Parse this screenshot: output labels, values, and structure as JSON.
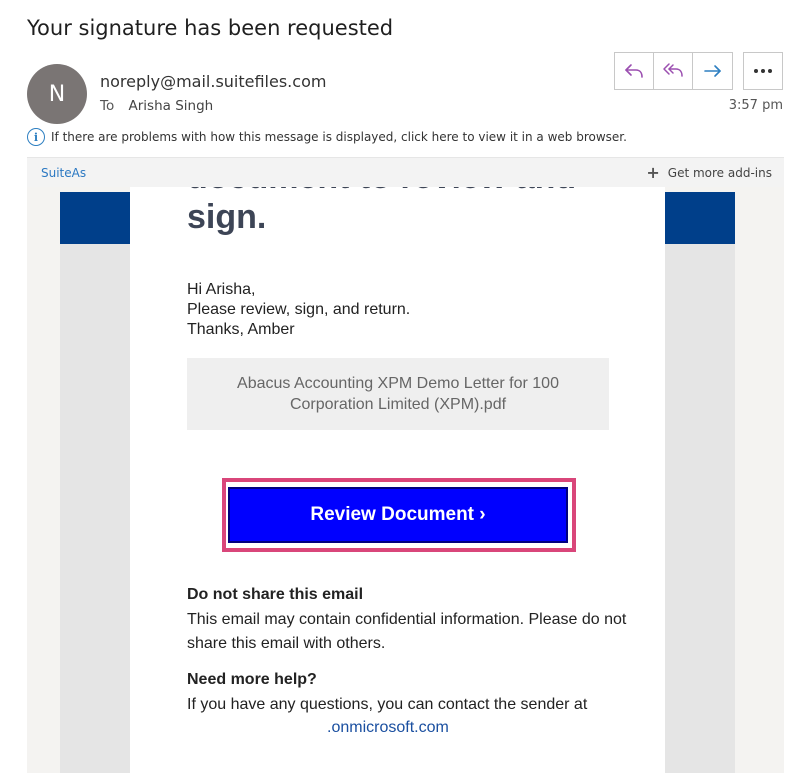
{
  "email": {
    "subject": "Your signature has been requested",
    "sender_initial": "N",
    "sender": "noreply@mail.suitefiles.com",
    "to_label": "To",
    "recipient": "Arisha Singh",
    "time": "3:57 pm",
    "info_message": "If there are problems with how this message is displayed, click here to view it in a web browser."
  },
  "toolbar": {
    "reply_icon": "reply-icon",
    "reply_all_icon": "reply-all-icon",
    "forward_icon": "forward-icon",
    "more_icon": "more-options-icon"
  },
  "addins": {
    "suiteas_label": "SuiteAs",
    "get_more_label": "Get more add-ins"
  },
  "body": {
    "headline_line1": "document to review and",
    "headline_line2": "sign.",
    "greeting": "Hi Arisha,",
    "message": "Please review, sign, and return.",
    "signoff": "Thanks, Amber",
    "document_name": "Abacus Accounting XPM Demo Letter for 100 Corporation Limited (XPM).pdf",
    "review_button": "Review Document ›",
    "share_title": "Do not share this email",
    "share_text": "This email may contain confidential information. Please do not share this email with others.",
    "help_title": "Need more help?",
    "help_text": "If you have any questions, you can contact the sender at",
    "contact_link": ".onmicrosoft.com"
  },
  "colors": {
    "accent_blue": "#003f8a",
    "button_blue": "#0000ff",
    "highlight_pink": "#d9467a",
    "icon_purple": "#9b4fb0",
    "icon_blue": "#2d7fc1"
  }
}
